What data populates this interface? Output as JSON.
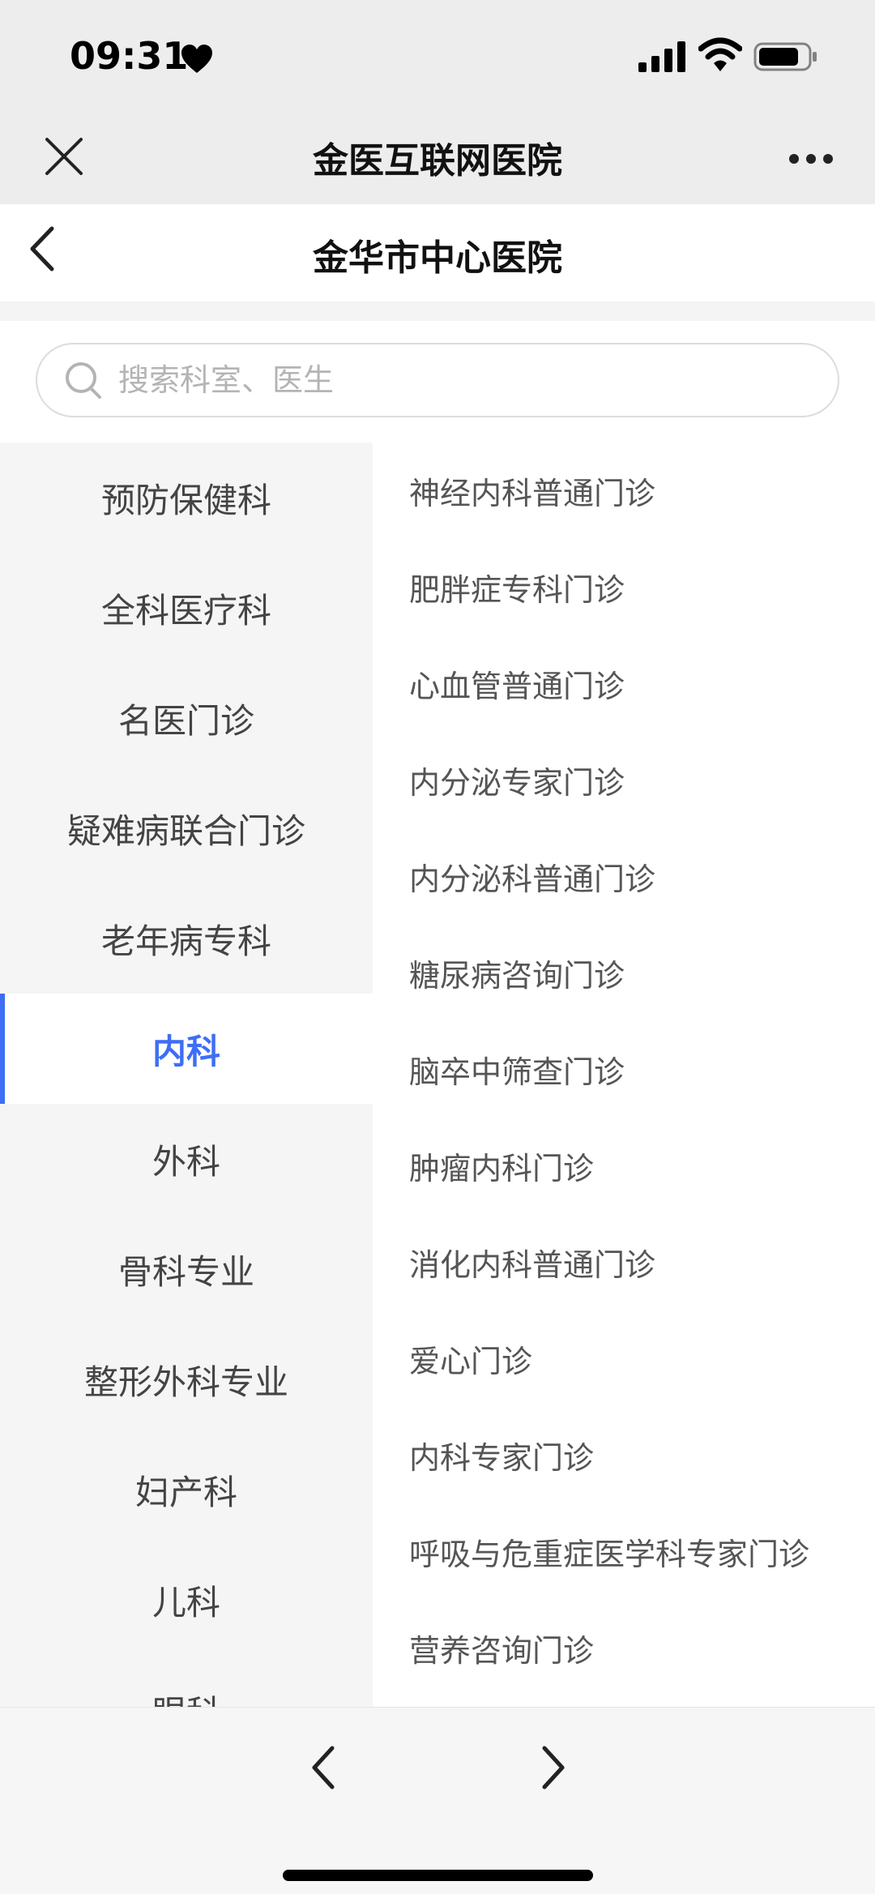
{
  "status_bar": {
    "time": "09:31",
    "icons": [
      "heart-icon",
      "cellular-signal-icon",
      "wifi-icon",
      "battery-icon"
    ]
  },
  "title_bar": {
    "title": "金医互联网医院",
    "close_icon": "close-icon",
    "more_icon": "more-icon"
  },
  "page_header": {
    "title": "金华市中心医院",
    "back_icon": "chevron-left-icon"
  },
  "search": {
    "placeholder": "搜索科室、医生",
    "value": "",
    "icon": "search-icon"
  },
  "departments": {
    "active_index": 5,
    "accent_color": "#3d6ef5",
    "items": [
      "预防保健科",
      "全科医疗科",
      "名医门诊",
      "疑难病联合门诊",
      "老年病专科",
      "内科",
      "外科",
      "骨科专业",
      "整形外科专业",
      "妇产科",
      "儿科",
      "眼科"
    ]
  },
  "clinics": {
    "items": [
      "神经内科普通门诊",
      "肥胖症专科门诊",
      "心血管普通门诊",
      "内分泌专家门诊",
      "内分泌科普通门诊",
      "糖尿病咨询门诊",
      "脑卒中筛查门诊",
      "肿瘤内科门诊",
      "消化内科普通门诊",
      "爱心门诊",
      "内科专家门诊",
      "呼吸与危重症医学科专家门诊",
      "营养咨询门诊"
    ]
  },
  "bottom_nav": {
    "back_icon": "chevron-left-icon",
    "forward_icon": "chevron-right-icon"
  }
}
